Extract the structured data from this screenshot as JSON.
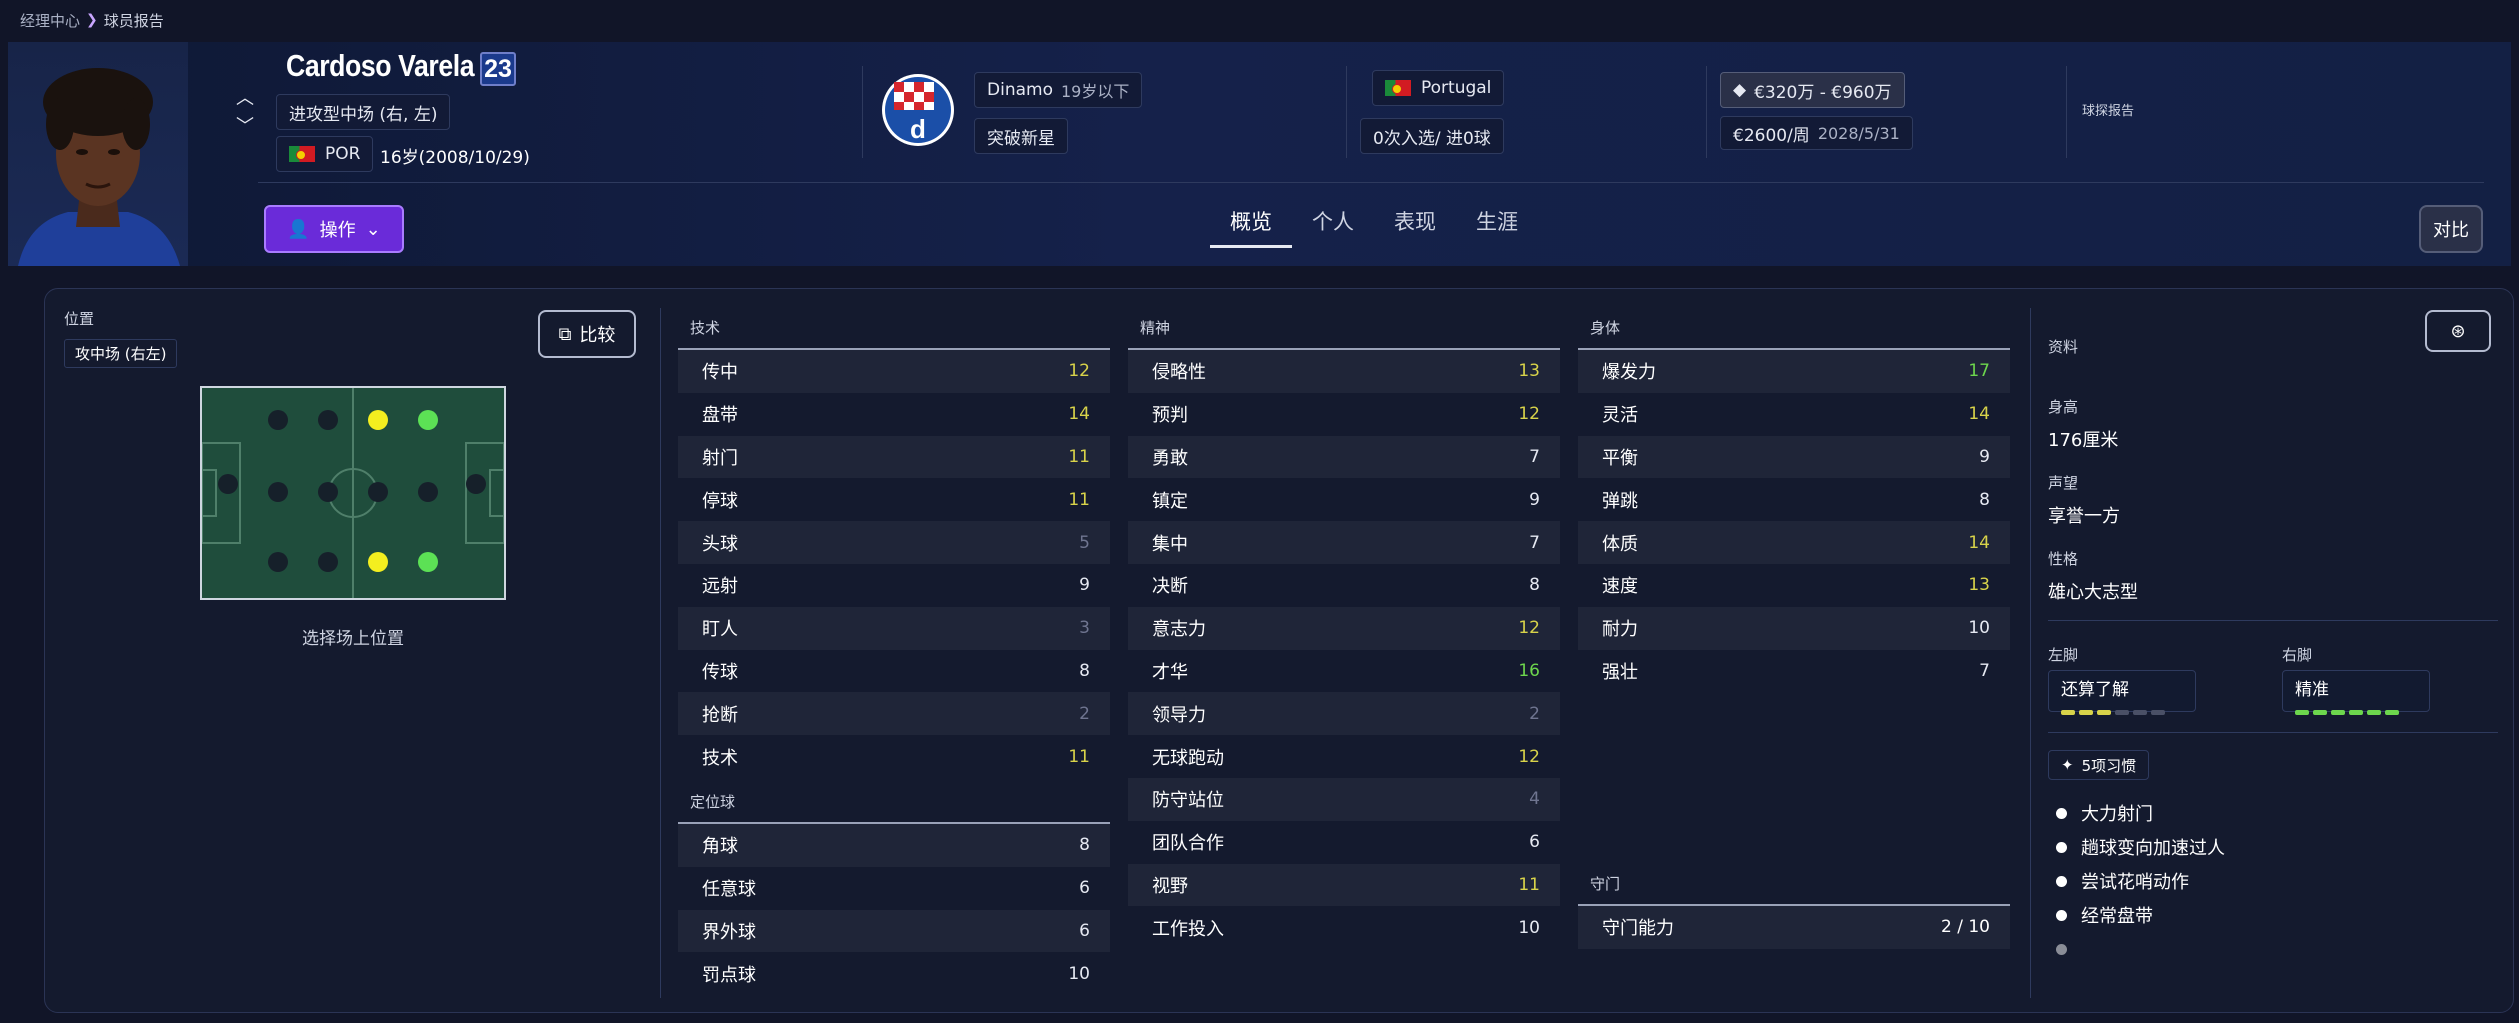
{
  "breadcrumb": {
    "parent": "经理中心",
    "current": "球员报告"
  },
  "player": {
    "name": "Cardoso Varela",
    "number": "23",
    "position": "进攻型中场 (右, 左)",
    "nation_code": "POR",
    "age_dob": "16岁(2008/10/29)"
  },
  "club": {
    "name": "Dinamo",
    "squad": "19岁以下",
    "tag": "突破新星"
  },
  "nation": {
    "name": "Portugal",
    "caps": "0次入选/ 进0球"
  },
  "value": {
    "range": "€320万 - €960万",
    "wage": "€2600/周",
    "contract_end": "2028/5/31"
  },
  "scout_report": "球探报告",
  "actions": {
    "ops_label": "操作",
    "compare_label": "对比"
  },
  "tabs": [
    "概览",
    "个人",
    "表现",
    "生涯"
  ],
  "position_panel": {
    "label": "位置",
    "current": "攻中场 (右左)",
    "compare": "比较",
    "hint": "选择场上位置"
  },
  "technical": {
    "title": "技术",
    "rows": [
      {
        "name": "传中",
        "value": 12,
        "color": "#d8d34a"
      },
      {
        "name": "盘带",
        "value": 14,
        "color": "#d8d34a"
      },
      {
        "name": "射门",
        "value": 11,
        "color": "#d8d34a"
      },
      {
        "name": "停球",
        "value": 11,
        "color": "#d8d34a"
      },
      {
        "name": "头球",
        "value": 5,
        "color": "#6f7590"
      },
      {
        "name": "远射",
        "value": 9,
        "color": "#e6e9f2"
      },
      {
        "name": "盯人",
        "value": 3,
        "color": "#6f7590"
      },
      {
        "name": "传球",
        "value": 8,
        "color": "#e6e9f2"
      },
      {
        "name": "抢断",
        "value": 2,
        "color": "#6f7590"
      },
      {
        "name": "技术",
        "value": 11,
        "color": "#d8d34a"
      }
    ]
  },
  "set_pieces": {
    "title": "定位球",
    "rows": [
      {
        "name": "角球",
        "value": 8,
        "color": "#e6e9f2"
      },
      {
        "name": "任意球",
        "value": 6,
        "color": "#e6e9f2"
      },
      {
        "name": "界外球",
        "value": 6,
        "color": "#e6e9f2"
      },
      {
        "name": "罚点球",
        "value": 10,
        "color": "#e6e9f2"
      }
    ]
  },
  "mental": {
    "title": "精神",
    "rows": [
      {
        "name": "侵略性",
        "value": 13,
        "color": "#d8d34a"
      },
      {
        "name": "预判",
        "value": 12,
        "color": "#d8d34a"
      },
      {
        "name": "勇敢",
        "value": 7,
        "color": "#e6e9f2"
      },
      {
        "name": "镇定",
        "value": 9,
        "color": "#e6e9f2"
      },
      {
        "name": "集中",
        "value": 7,
        "color": "#e6e9f2"
      },
      {
        "name": "决断",
        "value": 8,
        "color": "#e6e9f2"
      },
      {
        "name": "意志力",
        "value": 12,
        "color": "#d8d34a"
      },
      {
        "name": "才华",
        "value": 16,
        "color": "#6dd64d"
      },
      {
        "name": "领导力",
        "value": 2,
        "color": "#6f7590"
      },
      {
        "name": "无球跑动",
        "value": 12,
        "color": "#d8d34a"
      },
      {
        "name": "防守站位",
        "value": 4,
        "color": "#6f7590"
      },
      {
        "name": "团队合作",
        "value": 6,
        "color": "#e6e9f2"
      },
      {
        "name": "视野",
        "value": 11,
        "color": "#d8d34a"
      },
      {
        "name": "工作投入",
        "value": 10,
        "color": "#e6e9f2"
      }
    ]
  },
  "physical": {
    "title": "身体",
    "rows": [
      {
        "name": "爆发力",
        "value": 17,
        "color": "#6dd64d"
      },
      {
        "name": "灵活",
        "value": 14,
        "color": "#d8d34a"
      },
      {
        "name": "平衡",
        "value": 9,
        "color": "#e6e9f2"
      },
      {
        "name": "弹跳",
        "value": 8,
        "color": "#e6e9f2"
      },
      {
        "name": "体质",
        "value": 14,
        "color": "#d8d34a"
      },
      {
        "name": "速度",
        "value": 13,
        "color": "#d8d34a"
      },
      {
        "name": "耐力",
        "value": 10,
        "color": "#e6e9f2"
      },
      {
        "name": "强壮",
        "value": 7,
        "color": "#e6e9f2"
      }
    ]
  },
  "goalkeeping": {
    "title": "守门",
    "name": "守门能力",
    "value": "2 / 10"
  },
  "info": {
    "title": "资料",
    "height_label": "身高",
    "height": "176厘米",
    "rep_label": "声望",
    "rep": "享誉一方",
    "pers_label": "性格",
    "pers": "雄心大志型",
    "left_foot_label": "左脚",
    "left_foot": "还算了解",
    "left_foot_level": 3,
    "right_foot_label": "右脚",
    "right_foot": "精准",
    "right_foot_level": 6,
    "habits_label": "5项习惯",
    "habits": [
      "大力射门",
      "趟球变向加速过人",
      "尝试花哨动作",
      "经常盘带"
    ]
  },
  "colors": {
    "accent": "#6a2bd9",
    "yellow": "#d8d34a",
    "green": "#6dd64d"
  }
}
